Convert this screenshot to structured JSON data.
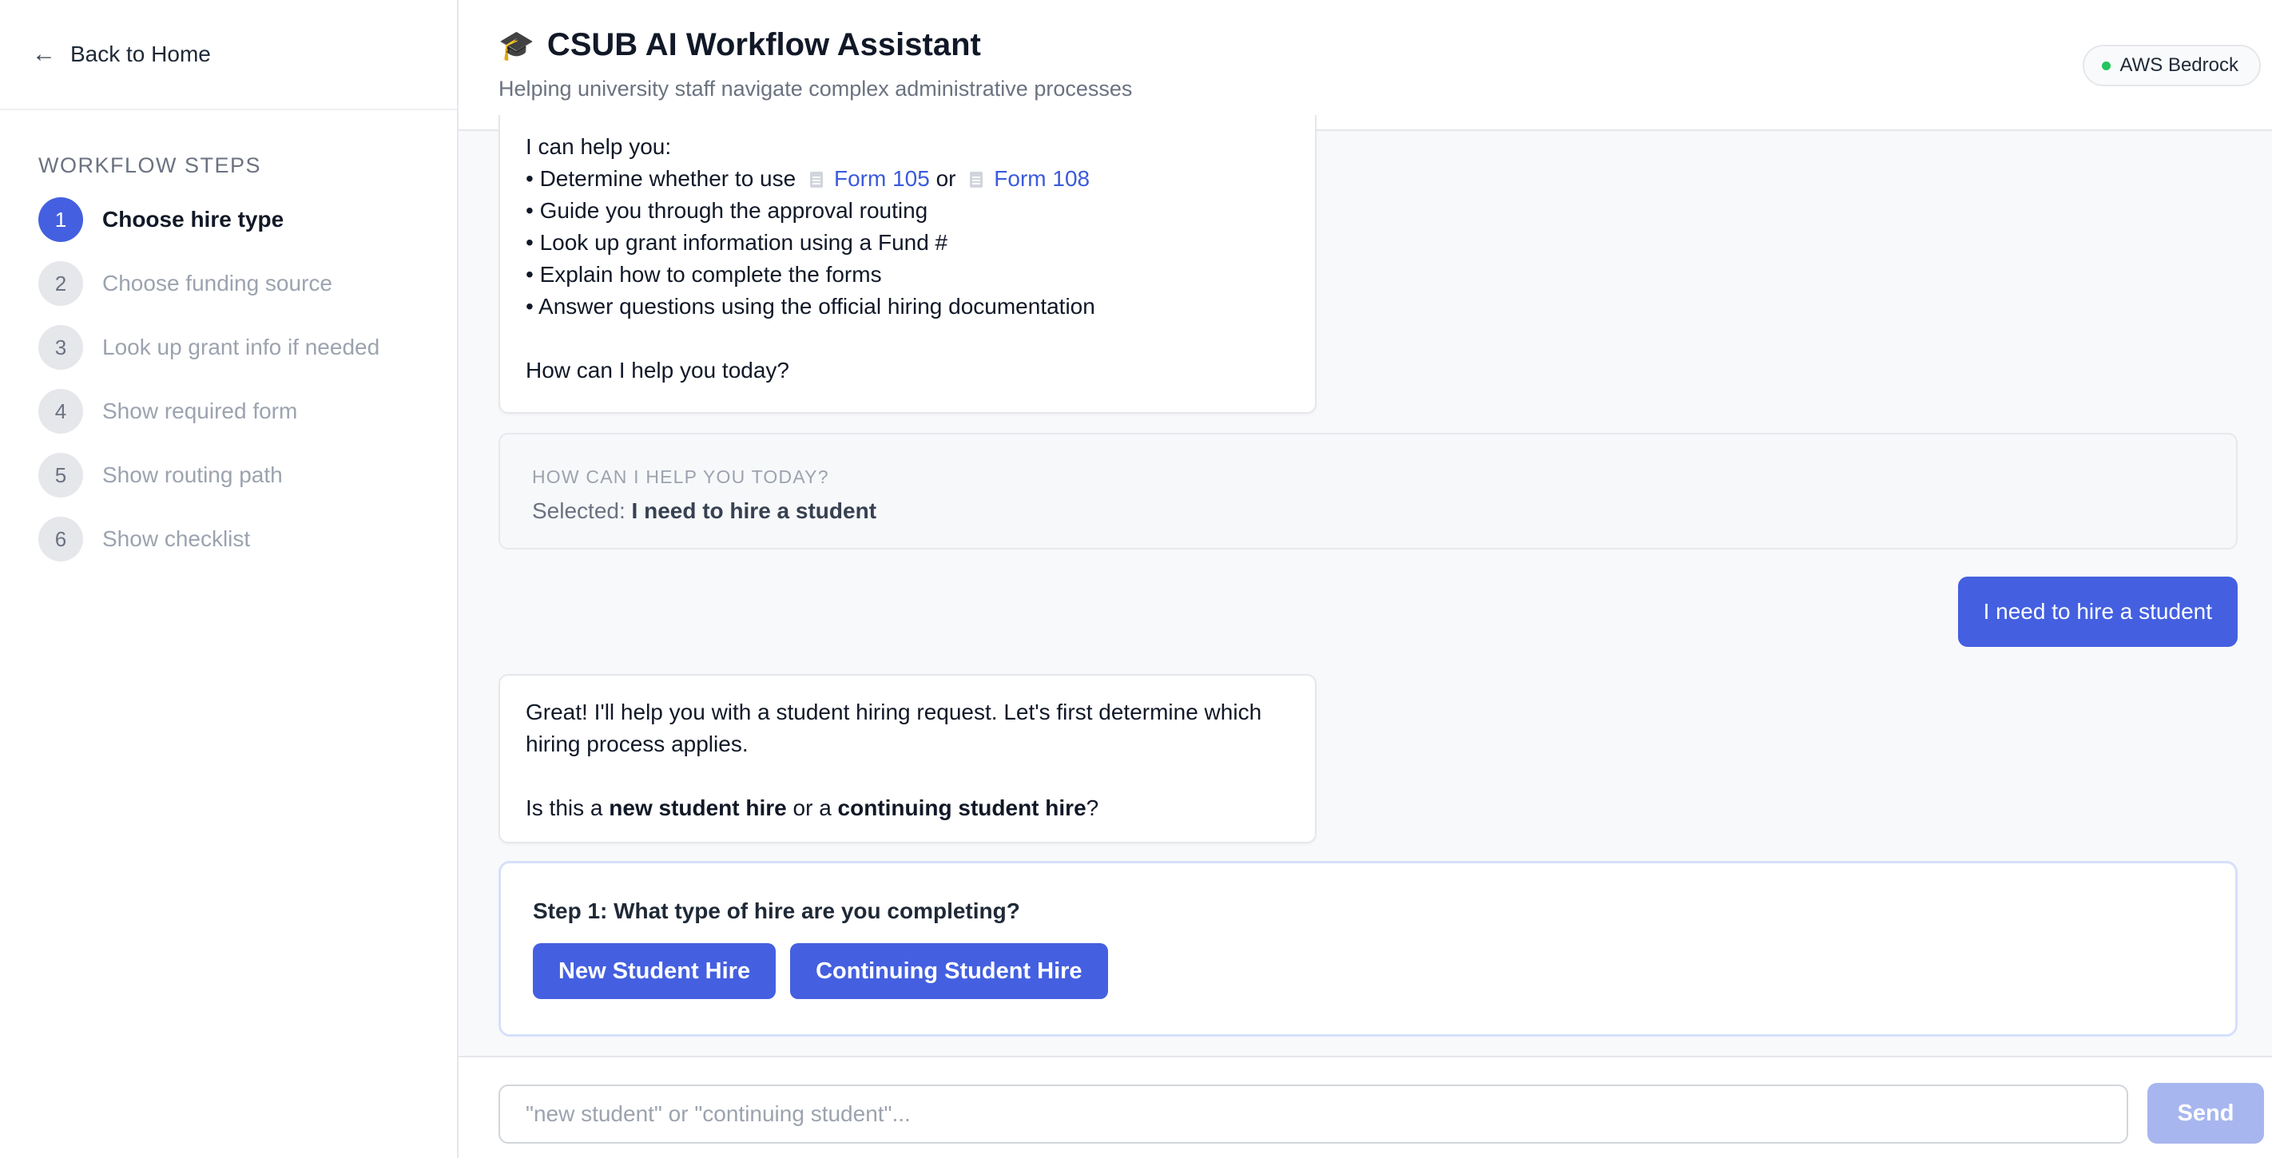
{
  "sidebar": {
    "back_label": "Back to Home",
    "back_arrow": "←",
    "steps_title": "WORKFLOW STEPS",
    "steps": [
      {
        "num": "1",
        "label": "Choose hire type"
      },
      {
        "num": "2",
        "label": "Choose funding source"
      },
      {
        "num": "3",
        "label": "Look up grant info if needed"
      },
      {
        "num": "4",
        "label": "Show required form"
      },
      {
        "num": "5",
        "label": "Show routing path"
      },
      {
        "num": "6",
        "label": "Show checklist"
      }
    ],
    "active_step": 1
  },
  "header": {
    "icon": "🎓",
    "title": "CSUB AI Workflow Assistant",
    "subtitle": "Helping university staff navigate complex administrative processes",
    "badge": "AWS Bedrock"
  },
  "messages": {
    "intro": {
      "lead": "I can help you:",
      "bullet1_pre": "• Determine whether to use",
      "form_105": "Form 105",
      "or": "or",
      "form_108": "Form 108",
      "bullet2": "• Guide you through the approval routing",
      "bullet3": "• Look up grant information using a Fund #",
      "bullet4": "• Explain how to complete the forms",
      "bullet5": "• Answer questions using the official hiring documentation",
      "closing": "How can I help you today?"
    },
    "selection": {
      "caption": "HOW CAN I HELP YOU TODAY?",
      "prefix": "Selected: ",
      "value": "I need to hire a student"
    },
    "user": "I need to hire a student",
    "assistant": {
      "line1": "Great! I'll help you with a student hiring request. Let's first determine which hiring process applies.",
      "q_pre": "Is this a ",
      "q_new": "new student hire",
      "q_mid": " or a ",
      "q_cont": "continuing student hire",
      "q_post": "?"
    }
  },
  "step_card": {
    "question": "Step 1: What type of hire are you completing?",
    "options": [
      "New Student Hire",
      "Continuing Student Hire"
    ]
  },
  "composer": {
    "placeholder": "\"new student\" or \"continuing student\"...",
    "value": "",
    "send_label": "Send"
  },
  "colors": {
    "accent": "#4460e0",
    "link": "#3b5bdb",
    "send_disabled": "#a7b6ee",
    "status_dot": "#22c55e"
  },
  "icons": {
    "back": "arrow-left-icon",
    "title": "graduation-cap-icon",
    "form": "document-icon",
    "status": "status-dot-icon"
  }
}
